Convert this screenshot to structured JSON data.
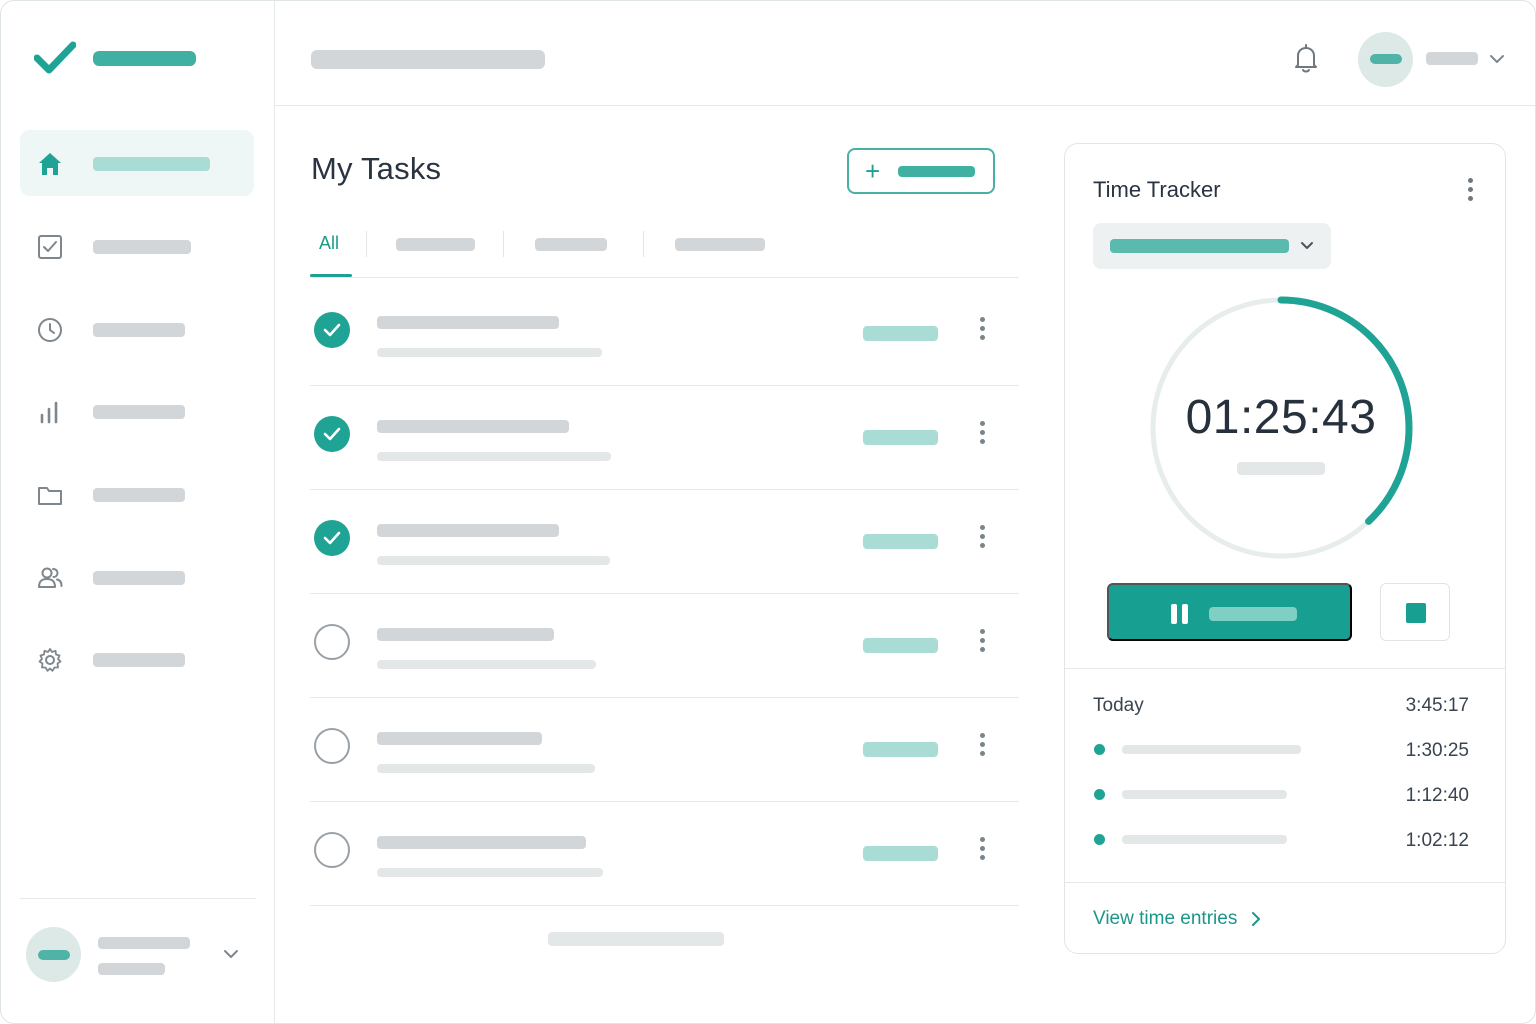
{
  "colors": {
    "accent": "#1ea394",
    "accent_soft": "#a8dcd5",
    "skeleton": "#d3d6d8",
    "text": "#2a3441"
  },
  "icons": {
    "logo": "checkmark-icon",
    "nav": [
      "home-icon",
      "task-checkbox-icon",
      "clock-icon",
      "bar-chart-icon",
      "folder-icon",
      "users-icon",
      "gear-icon"
    ],
    "top": [
      "bell-icon",
      "chevron-down-icon"
    ]
  },
  "sidebar": {
    "active_index": 0
  },
  "main": {
    "title": "My Tasks",
    "add_button_icon": "+",
    "tabs": {
      "active_label": "All"
    },
    "tasks": [
      {
        "completed": true
      },
      {
        "completed": true
      },
      {
        "completed": true
      },
      {
        "completed": false
      },
      {
        "completed": false
      },
      {
        "completed": false
      }
    ]
  },
  "tracker": {
    "title": "Time Tracker",
    "timer": "01:25:43",
    "progress": 0.38,
    "today_label": "Today",
    "today_total": "3:45:17",
    "entries": [
      {
        "time": "1:30:25"
      },
      {
        "time": "1:12:40"
      },
      {
        "time": "1:02:12"
      }
    ],
    "view_link": "View time entries"
  }
}
